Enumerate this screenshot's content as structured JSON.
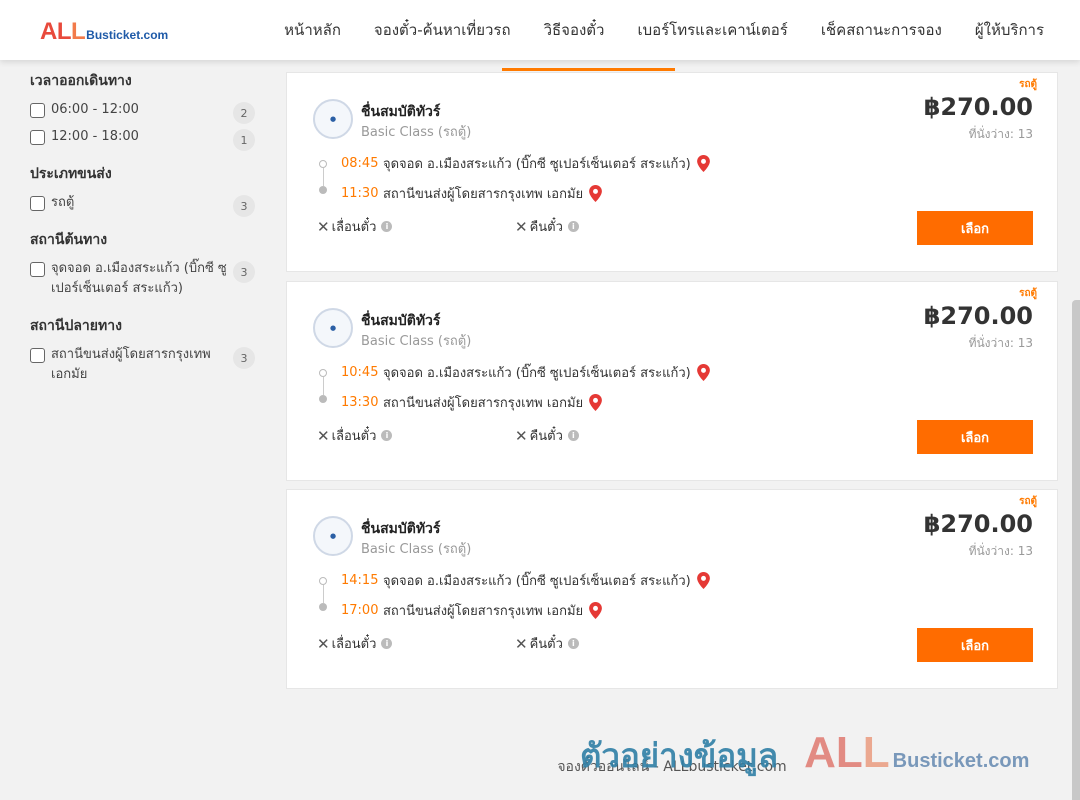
{
  "header": {
    "logo_all": "ALL",
    "logo_rest": "Busticket.com",
    "nav": [
      "หน้าหลัก",
      "จองตั๋ว-ค้นหาเที่ยวรถ",
      "วิธีจองตั๋ว",
      "เบอร์โทรและเคาน์เตอร์",
      "เช็คสถานะการจอง",
      "ผู้ให้บริการ"
    ],
    "active_nav": "วิธีจองตั๋ว",
    "accent_color": "#ff7a00"
  },
  "filters": {
    "departure_time": {
      "title": "เวลาออกเดินทาง",
      "options": [
        {
          "label": "06:00 - 12:00",
          "count": "2"
        },
        {
          "label": "12:00 - 18:00",
          "count": "1"
        }
      ]
    },
    "transport_type": {
      "title": "ประเภทขนส่ง",
      "options": [
        {
          "label": "รถตู้",
          "count": "3"
        }
      ]
    },
    "origin": {
      "title": "สถานีต้นทาง",
      "options": [
        {
          "label": "จุดจอด อ.เมืองสระแก้ว (บิ๊กซี ซูเปอร์เซ็นเตอร์ สระแก้ว)",
          "count": "3"
        }
      ]
    },
    "destination": {
      "title": "สถานีปลายทาง",
      "options": [
        {
          "label": "สถานีขนส่งผู้โดยสารกรุงเทพ เอกมัย",
          "count": "3"
        }
      ]
    }
  },
  "trips": [
    {
      "tag": "รถตู้",
      "operator": "ชื่นสมบัติทัวร์",
      "class": "Basic Class (รถตู้)",
      "price": "฿270.00",
      "seats": "ที่นั่งว่าง: 13",
      "dep_time": "08:45",
      "dep_station": "จุดจอด อ.เมืองสระแก้ว (บิ๊กซี ซูเปอร์เซ็นเตอร์ สระแก้ว)",
      "arr_time": "11:30",
      "arr_station": "สถานีขนส่งผู้โดยสารกรุงเทพ เอกมัย",
      "reschedule": "เลื่อนตั๋ว",
      "refund": "คืนตั๋ว",
      "button": "เลือก"
    },
    {
      "tag": "รถตู้",
      "operator": "ชื่นสมบัติทัวร์",
      "class": "Basic Class (รถตู้)",
      "price": "฿270.00",
      "seats": "ที่นั่งว่าง: 13",
      "dep_time": "10:45",
      "dep_station": "จุดจอด อ.เมืองสระแก้ว (บิ๊กซี ซูเปอร์เซ็นเตอร์ สระแก้ว)",
      "arr_time": "13:30",
      "arr_station": "สถานีขนส่งผู้โดยสารกรุงเทพ เอกมัย",
      "reschedule": "เลื่อนตั๋ว",
      "refund": "คืนตั๋ว",
      "button": "เลือก"
    },
    {
      "tag": "รถตู้",
      "operator": "ชื่นสมบัติทัวร์",
      "class": "Basic Class (รถตู้)",
      "price": "฿270.00",
      "seats": "ที่นั่งว่าง: 13",
      "dep_time": "14:15",
      "dep_station": "จุดจอด อ.เมืองสระแก้ว (บิ๊กซี ซูเปอร์เซ็นเตอร์ สระแก้ว)",
      "arr_time": "17:00",
      "arr_station": "สถานีขนส่งผู้โดยสารกรุงเทพ เอกมัย",
      "reschedule": "เลื่อนตั๋ว",
      "refund": "คืนตั๋ว",
      "button": "เลือก"
    }
  ],
  "footer": {
    "text": "จองตั๋วออนไลน์ - ALLbusticket.com"
  },
  "watermark": {
    "text": "ตัวอย่างข้อมูล",
    "logo_all": "ALL",
    "logo_rest": "Busticket.com"
  }
}
